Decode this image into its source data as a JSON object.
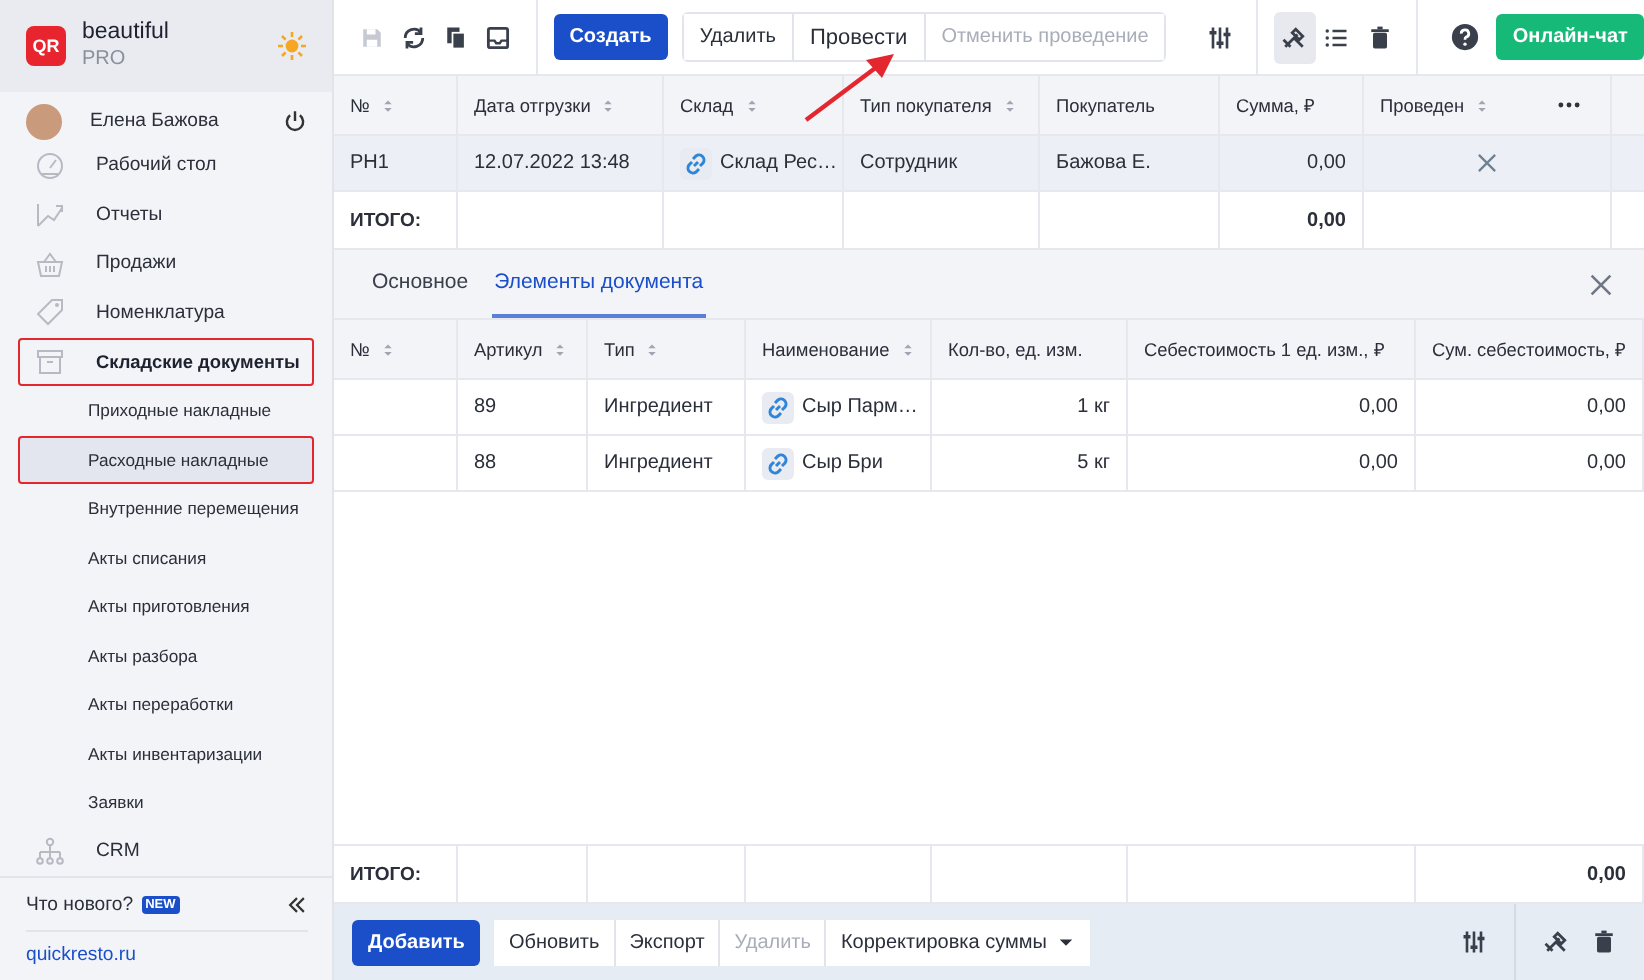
{
  "sidebar": {
    "brand": {
      "logo_text": "QR",
      "name": "beautiful",
      "plan": "PRO"
    },
    "user": {
      "name": "Елена Бажова"
    },
    "items": [
      {
        "label": "Рабочий стол",
        "kind": "dashboard",
        "selected": false,
        "highlighted": false,
        "expanded": false
      },
      {
        "label": "Отчеты",
        "kind": "chart",
        "selected": false,
        "highlighted": false,
        "expanded": false
      },
      {
        "label": "Продажи",
        "kind": "basket",
        "selected": false,
        "highlighted": false,
        "expanded": false
      },
      {
        "label": "Номенклатура",
        "kind": "tag",
        "selected": false,
        "highlighted": false,
        "expanded": false
      },
      {
        "label": "Складские документы",
        "kind": "archive",
        "selected": false,
        "highlighted": true,
        "expanded": true,
        "children": [
          {
            "label": "Приходные накладные",
            "selected": false,
            "highlighted": false
          },
          {
            "label": "Расходные накладные",
            "selected": true,
            "highlighted": true
          },
          {
            "label": "Внутренние перемещения",
            "selected": false,
            "highlighted": false
          },
          {
            "label": "Акты списания",
            "selected": false,
            "highlighted": false
          },
          {
            "label": "Акты приготовления",
            "selected": false,
            "highlighted": false
          },
          {
            "label": "Акты разбора",
            "selected": false,
            "highlighted": false
          },
          {
            "label": "Акты переработки",
            "selected": false,
            "highlighted": false
          },
          {
            "label": "Акты инвентаризации",
            "selected": false,
            "highlighted": false
          },
          {
            "label": "Заявки",
            "selected": false,
            "highlighted": false
          }
        ]
      },
      {
        "label": "CRM",
        "kind": "crm",
        "selected": false,
        "highlighted": false,
        "expanded": false
      }
    ],
    "footer": {
      "whats_new": "Что нового?",
      "badge": "NEW",
      "link": "quickresto.ru"
    }
  },
  "toolbar": {
    "icon_buttons": [
      {
        "kind": "save",
        "disabled": true
      },
      {
        "kind": "refresh",
        "disabled": false
      },
      {
        "kind": "copy",
        "disabled": false
      },
      {
        "kind": "tray",
        "disabled": false
      }
    ],
    "create": "Создать",
    "actions": [
      {
        "label": "Удалить",
        "disabled": false
      },
      {
        "label": "Провести",
        "disabled": false
      },
      {
        "label": "Отменить проведение",
        "disabled": true
      }
    ],
    "view_buttons": [
      {
        "kind": "tools",
        "selected": true
      },
      {
        "kind": "list",
        "selected": false
      },
      {
        "kind": "trash",
        "selected": false
      }
    ],
    "chat": "Онлайн-чат"
  },
  "documents_table": {
    "columns": [
      {
        "label": "№",
        "sortable": true,
        "kind": "text"
      },
      {
        "label": "Дата отгрузки",
        "sortable": true,
        "kind": "text"
      },
      {
        "label": "Склад",
        "sortable": true,
        "kind": "link"
      },
      {
        "label": "Тип покупателя",
        "sortable": true,
        "kind": "text"
      },
      {
        "label": "Покупатель",
        "sortable": false,
        "kind": "text"
      },
      {
        "label": "Сумма, ₽",
        "sortable": false,
        "kind": "number",
        "total": "0,00"
      },
      {
        "label": "Проведен",
        "sortable": true,
        "kind": "status"
      }
    ],
    "rows": [
      {
        "selected": true,
        "posted": false,
        "cells": [
          "РН1",
          "12.07.2022 13:48",
          "Склад Рес…",
          "Сотрудник",
          "Бажова Е.",
          "0,00"
        ]
      }
    ],
    "total_label": "ИТОГО:"
  },
  "detail": {
    "tabs": [
      {
        "label": "Основное",
        "selected": false
      },
      {
        "label": "Элементы документа",
        "selected": true
      }
    ],
    "table": {
      "columns": [
        {
          "label": "№",
          "sortable": true,
          "kind": "text"
        },
        {
          "label": "Артикул",
          "sortable": true,
          "kind": "text"
        },
        {
          "label": "Тип",
          "sortable": true,
          "kind": "text"
        },
        {
          "label": "Наименование",
          "sortable": true,
          "kind": "link"
        },
        {
          "label": "Кол-во, ед. изм.",
          "sortable": false,
          "kind": "number"
        },
        {
          "label": "Себестоимость 1 ед. изм., ₽",
          "sortable": false,
          "kind": "number"
        },
        {
          "label": "Сум. себестоимость, ₽",
          "sortable": false,
          "kind": "number",
          "total": "0,00"
        }
      ],
      "rows": [
        {
          "selected": false,
          "cells": [
            null,
            "89",
            "Ингредиент",
            "Сыр Парм…",
            "1 кг",
            "0,00",
            "0,00"
          ]
        },
        {
          "selected": false,
          "cells": [
            null,
            "88",
            "Ингредиент",
            "Сыр Бри",
            "5 кг",
            "0,00",
            "0,00"
          ]
        }
      ],
      "total_label": "ИТОГО:"
    }
  },
  "bottom_toolbar": {
    "add": "Добавить",
    "actions": [
      {
        "label": "Обновить",
        "disabled": false,
        "kind": "button"
      },
      {
        "label": "Экспорт",
        "disabled": false,
        "kind": "button"
      },
      {
        "label": "Удалить",
        "disabled": true,
        "kind": "button"
      },
      {
        "label": "Корректировка суммы",
        "disabled": false,
        "kind": "dropdown"
      }
    ],
    "view_buttons": [
      {
        "kind": "tools",
        "selected": false
      },
      {
        "kind": "trash",
        "selected": false
      }
    ]
  }
}
